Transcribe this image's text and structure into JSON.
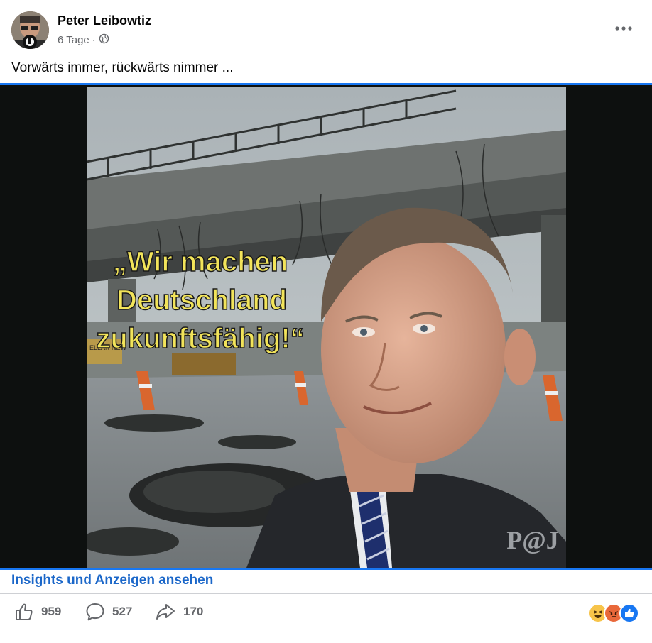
{
  "post": {
    "author": "Peter Leibowtiz",
    "time": "6 Tage",
    "separator": "·",
    "caption": "Vorwärts immer, rückwärts nimmer ..."
  },
  "image": {
    "quote_lines": [
      "„Wir machen",
      "Deutschland",
      "zukunftsfähig!“"
    ],
    "watermark": "P@J",
    "sign_text": "ELLAN NEW"
  },
  "insights_link": "Insights und Anzeigen ansehen",
  "stats": {
    "likes": "959",
    "comments": "527",
    "shares": "170"
  },
  "reactions": [
    "haha-icon",
    "angry-icon",
    "like-icon"
  ],
  "colors": {
    "accent": "#1877f2",
    "link": "#1b67c9",
    "muted": "#65676b"
  }
}
